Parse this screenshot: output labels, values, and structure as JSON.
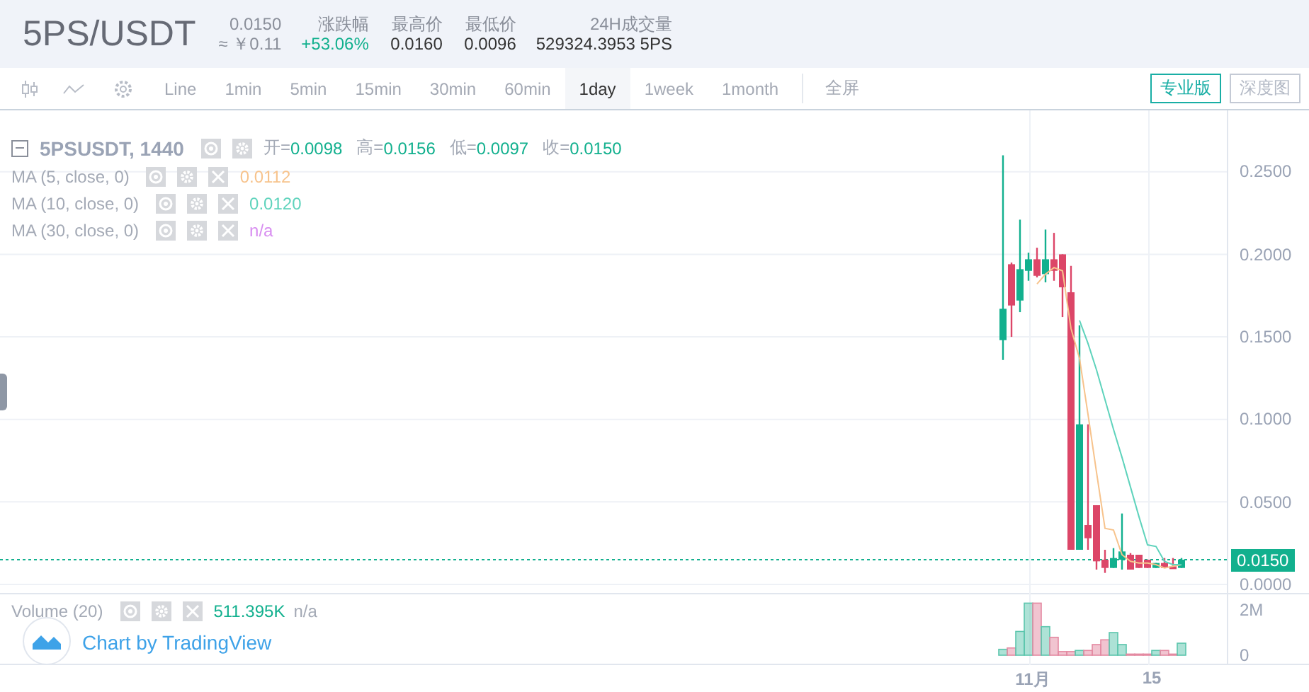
{
  "header": {
    "symbol": "5PS/USDT",
    "price": "0.0150",
    "price_cny": "≈ ￥0.11",
    "stats": [
      {
        "label": "涨跌幅",
        "value": "+53.06%",
        "rising": true
      },
      {
        "label": "最高价",
        "value": "0.0160",
        "rising": false
      },
      {
        "label": "最低价",
        "value": "0.0096",
        "rising": false
      },
      {
        "label": "24H成交量",
        "value": "529324.3953 5PS",
        "rising": false
      }
    ]
  },
  "toolbar": {
    "intervals": [
      {
        "label": "Line",
        "selected": false
      },
      {
        "label": "1min",
        "selected": false
      },
      {
        "label": "5min",
        "selected": false
      },
      {
        "label": "15min",
        "selected": false
      },
      {
        "label": "30min",
        "selected": false
      },
      {
        "label": "60min",
        "selected": false
      },
      {
        "label": "1day",
        "selected": true
      },
      {
        "label": "1week",
        "selected": false
      },
      {
        "label": "1month",
        "selected": false
      }
    ],
    "fullscreen": "全屏",
    "views": [
      {
        "label": "专业版",
        "selected": true
      },
      {
        "label": "深度图",
        "selected": false
      }
    ]
  },
  "legend": {
    "title": "5PSUSDT, 1440",
    "ohlc": [
      {
        "label": "开=",
        "value": "0.0098"
      },
      {
        "label": "高=",
        "value": "0.0156"
      },
      {
        "label": "低=",
        "value": "0.0097"
      },
      {
        "label": "收=",
        "value": "0.0150"
      }
    ]
  },
  "indicators": [
    {
      "name": "MA (5, close, 0)",
      "value": "0.0112",
      "color": "#f7c38c"
    },
    {
      "name": "MA (10, close, 0)",
      "value": "0.0120",
      "color": "#5fd3bc"
    },
    {
      "name": "MA (30, close, 0)",
      "value": "n/a",
      "color": "#d88ef0"
    }
  ],
  "price_chart": {
    "chart_data": {
      "type": "candlestick",
      "categories": [
        null,
        null,
        null,
        null,
        null,
        null,
        null,
        null,
        null,
        null,
        null,
        null,
        null,
        null,
        null,
        null,
        null,
        null,
        null,
        null,
        null,
        null
      ],
      "grid": true,
      "ohlc": [
        [
          0.148,
          0.26,
          0.136,
          0.167
        ],
        [
          0.194,
          0.195,
          0.15,
          0.169
        ],
        [
          0.172,
          0.221,
          0.165,
          0.191
        ],
        [
          0.19,
          0.201,
          0.184,
          0.197
        ],
        [
          0.197,
          0.204,
          0.186,
          0.187
        ],
        [
          0.188,
          0.215,
          0.183,
          0.197
        ],
        [
          0.197,
          0.213,
          0.184,
          0.19
        ],
        [
          0.2,
          0.2,
          0.162,
          0.18
        ],
        [
          0.177,
          0.193,
          0.021,
          0.021
        ],
        [
          0.021,
          0.157,
          0.021,
          0.097
        ],
        [
          0.036,
          0.097,
          0.021,
          0.028
        ],
        [
          0.048,
          0.048,
          0.009,
          0.014
        ],
        [
          0.015,
          0.021,
          0.007,
          0.01
        ],
        [
          0.01,
          0.022,
          0.01,
          0.016
        ],
        [
          0.015,
          0.043,
          0.009,
          0.02
        ],
        [
          0.018,
          0.019,
          0.009,
          0.009
        ],
        [
          0.018,
          0.018,
          0.01,
          0.01
        ],
        [
          0.015,
          0.015,
          0.01,
          0.01
        ],
        [
          0.01,
          0.013,
          0.01,
          0.013
        ],
        [
          0.013,
          0.016,
          0.01,
          0.01
        ],
        [
          0.011,
          0.016,
          0.01,
          0.01
        ],
        [
          0.01,
          0.016,
          0.01,
          0.015
        ]
      ],
      "series": [
        {
          "type": "line",
          "color": "#f7c38c",
          "values": [
            null,
            null,
            null,
            null,
            0.182,
            0.188,
            0.192,
            0.19,
            0.155,
            0.137,
            0.103,
            0.068,
            0.034,
            0.033,
            0.018,
            0.014,
            0.013,
            0.013,
            0.012,
            0.01,
            0.011,
            0.012
          ]
        },
        {
          "type": "line",
          "color": "#5fd3bc",
          "values": [
            null,
            null,
            null,
            null,
            null,
            null,
            null,
            null,
            null,
            0.16,
            0.146,
            0.13,
            0.112,
            0.094,
            0.077,
            0.059,
            0.041,
            0.024,
            0.023,
            0.014,
            0.012,
            0.012
          ]
        }
      ],
      "ylim": [
        0,
        0.2872
      ],
      "ref_lines": [
        {
          "axis": "y",
          "value": 0.015
        }
      ],
      "yticks": [
        {
          "value": 0.25,
          "label": "0.2500"
        },
        {
          "value": 0.2,
          "label": "0.2000"
        },
        {
          "value": 0.15,
          "label": "0.1500"
        },
        {
          "value": 0.1,
          "label": "0.1000"
        },
        {
          "value": 0.05,
          "label": "0.0500"
        },
        {
          "value": 0,
          "label": "0.0000"
        }
      ]
    }
  },
  "time_axis": [
    "11月",
    "15"
  ],
  "last_price": "0.0150",
  "volume": {
    "name": "Volume (20)",
    "value": "511.395K",
    "ma_value": "n/a",
    "chart_data": {
      "type": "bar",
      "categories": [
        null,
        null,
        null,
        null,
        null,
        null,
        null,
        null,
        null,
        null,
        null,
        null,
        null,
        null,
        null,
        null,
        null,
        null,
        null,
        null,
        null,
        null
      ],
      "values": [
        260000,
        320000,
        1050000,
        2300000,
        2300000,
        1260000,
        790000,
        160000,
        160000,
        210000,
        210000,
        470000,
        680000,
        1000000,
        470000,
        50000,
        50000,
        50000,
        210000,
        210000,
        50000,
        530000
      ],
      "ylim": [
        0,
        2687500
      ],
      "yticks": [
        {
          "value": 2000000,
          "label": "2M"
        },
        {
          "value": 0,
          "label": "0"
        }
      ]
    }
  },
  "attribution": "Chart by TradingView"
}
